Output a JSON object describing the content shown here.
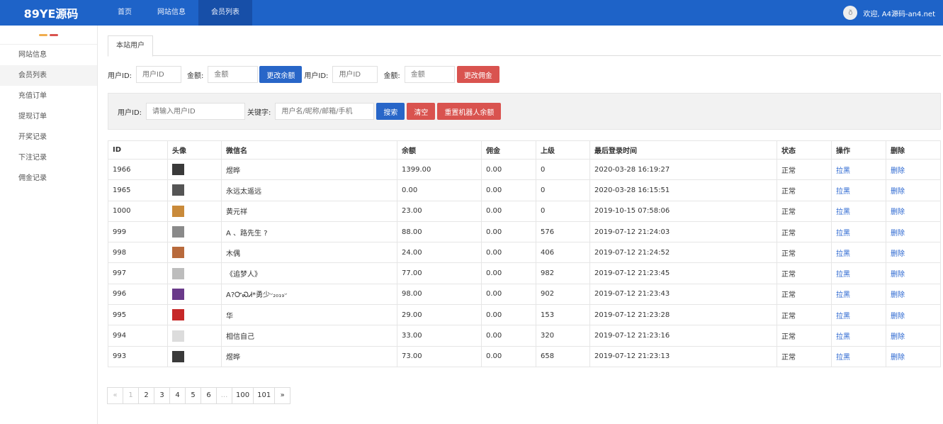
{
  "header": {
    "logo": "89YE源码",
    "nav": [
      "首页",
      "网站信息",
      "会员列表"
    ],
    "welcome": "欢迎, A4源码-an4.net",
    "avatar_glyph": "ð"
  },
  "sidebar": {
    "items": [
      "网站信息",
      "会员列表",
      "充值订单",
      "提现订单",
      "开奖记录",
      "下注记录",
      "佣金记录"
    ],
    "toggle_colors": [
      "#f0ad4e",
      "#d9534f"
    ]
  },
  "tab": {
    "label": "本站用户"
  },
  "balance_form": {
    "uid_label": "用户ID:",
    "uid_placeholder": "用户ID",
    "amount_label": "金额:",
    "amount_placeholder": "金额",
    "balance_button": "更改余额",
    "uid2_label": "用户ID:",
    "uid2_placeholder": "用户ID",
    "amount2_label": "金额:",
    "amount2_placeholder": "金额",
    "commission_button": "更改佣金"
  },
  "search": {
    "uid_label": "用户ID:",
    "uid_placeholder": "请输入用户ID",
    "keyword_label": "关键字:",
    "keyword_placeholder": "用户名/昵称/邮箱/手机",
    "search_button": "搜索",
    "clear_button": "清空",
    "reset_button": "重置机器人余额"
  },
  "table": {
    "columns": [
      "ID",
      "头像",
      "微信名",
      "余额",
      "佣金",
      "上级",
      "最后登录时间",
      "状态",
      "操作",
      "删除"
    ],
    "rows": [
      {
        "id": "1966",
        "avatar": "#3a3a3a",
        "name": "煜晔",
        "balance": "1399.00",
        "commission": "0.00",
        "parent": "0",
        "last_login": "2020-03-28 16:19:27",
        "status": "正常",
        "action": "拉黑",
        "delete": "删除"
      },
      {
        "id": "1965",
        "avatar": "#555555",
        "name": "永远太遥远",
        "balance": "0.00",
        "commission": "0.00",
        "parent": "0",
        "last_login": "2020-03-28 16:15:51",
        "status": "正常",
        "action": "拉黑",
        "delete": "删除"
      },
      {
        "id": "1000",
        "avatar": "#c98a3a",
        "name": "黄元祥",
        "balance": "23.00",
        "commission": "0.00",
        "parent": "0",
        "last_login": "2019-10-15 07:58:06",
        "status": "正常",
        "action": "拉黑",
        "delete": "删除"
      },
      {
        "id": "999",
        "avatar": "#8a8a8a",
        "name": "A 、路先生 ?",
        "balance": "88.00",
        "commission": "0.00",
        "parent": "576",
        "last_login": "2019-07-12 21:24:03",
        "status": "正常",
        "action": "拉黑",
        "delete": "删除"
      },
      {
        "id": "998",
        "avatar": "#b86a3c",
        "name": "木偶",
        "balance": "24.00",
        "commission": "0.00",
        "parent": "406",
        "last_login": "2019-07-12 21:24:52",
        "status": "正常",
        "action": "拉黑",
        "delete": "删除"
      },
      {
        "id": "997",
        "avatar": "#bdbdbd",
        "name": "《追梦人》",
        "balance": "77.00",
        "commission": "0.00",
        "parent": "982",
        "last_login": "2019-07-12 21:23:45",
        "status": "正常",
        "action": "拉黑",
        "delete": "删除"
      },
      {
        "id": "996",
        "avatar": "#6a3a8a",
        "name": "A?ᏅᏍᏗ*勇少ᵕ₂₀₁₉ᵕ",
        "balance": "98.00",
        "commission": "0.00",
        "parent": "902",
        "last_login": "2019-07-12 21:23:43",
        "status": "正常",
        "action": "拉黑",
        "delete": "删除"
      },
      {
        "id": "995",
        "avatar": "#c62828",
        "name": "华",
        "balance": "29.00",
        "commission": "0.00",
        "parent": "153",
        "last_login": "2019-07-12 21:23:28",
        "status": "正常",
        "action": "拉黑",
        "delete": "删除"
      },
      {
        "id": "994",
        "avatar": "#dcdcdc",
        "name": "相信自己",
        "balance": "33.00",
        "commission": "0.00",
        "parent": "320",
        "last_login": "2019-07-12 21:23:16",
        "status": "正常",
        "action": "拉黑",
        "delete": "删除"
      },
      {
        "id": "993",
        "avatar": "#3a3a3a",
        "name": "煜晔",
        "balance": "73.00",
        "commission": "0.00",
        "parent": "658",
        "last_login": "2019-07-12 21:23:13",
        "status": "正常",
        "action": "拉黑",
        "delete": "删除"
      }
    ]
  },
  "pagination": {
    "prev": "«",
    "pages": [
      "1",
      "2",
      "3",
      "4",
      "5",
      "6",
      "...",
      "100",
      "101"
    ],
    "next": "»"
  }
}
